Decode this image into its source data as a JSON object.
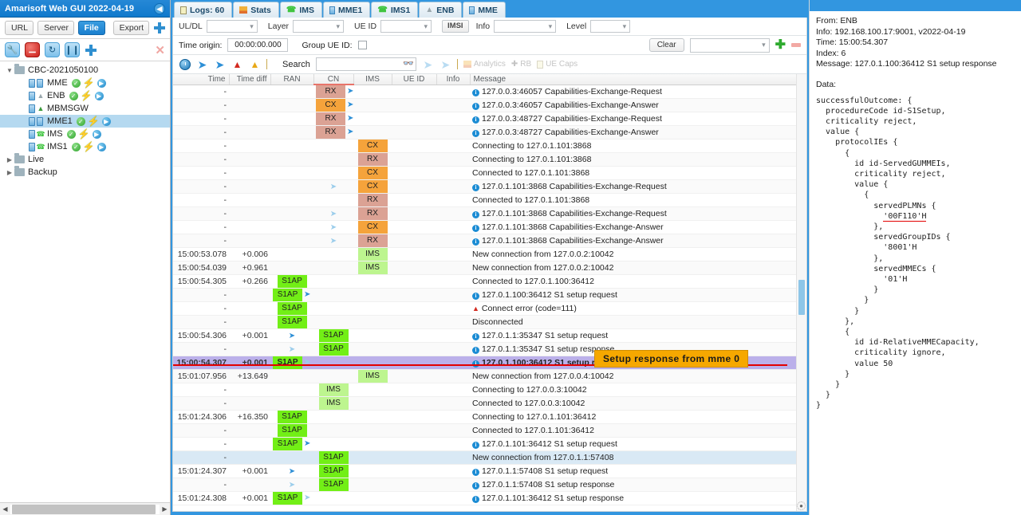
{
  "window": {
    "title": "Amarisoft Web GUI 2022-04-19",
    "collapse_icon": "chevron-left-icon"
  },
  "sidebar": {
    "source_buttons": [
      {
        "label": "URL",
        "active": false
      },
      {
        "label": "Server",
        "active": false
      },
      {
        "label": "File",
        "active": true
      }
    ],
    "export_label": "Export",
    "tool_icons": [
      "wrench-icon",
      "stop-icon",
      "refresh-icon",
      "pause-icon",
      "plus-icon",
      "close-icon"
    ],
    "tree": [
      {
        "label": "CBC-2021050100",
        "type": "folder",
        "expanded": true,
        "depth": 0,
        "selected": false,
        "status": []
      },
      {
        "label": "MME",
        "type": "server",
        "depth": 1,
        "selected": false,
        "status": [
          "check",
          "bolt",
          "play"
        ]
      },
      {
        "label": "ENB",
        "type": "enb",
        "depth": 1,
        "selected": false,
        "status": [
          "check",
          "bolt",
          "play"
        ]
      },
      {
        "label": "MBMSGW",
        "type": "gw",
        "depth": 1,
        "selected": false,
        "status": []
      },
      {
        "label": "MME1",
        "type": "server",
        "depth": 1,
        "selected": true,
        "status": [
          "check",
          "bolt",
          "play"
        ]
      },
      {
        "label": "IMS",
        "type": "phone",
        "depth": 1,
        "selected": false,
        "status": [
          "check",
          "bolt",
          "play"
        ]
      },
      {
        "label": "IMS1",
        "type": "phone",
        "depth": 1,
        "selected": false,
        "status": [
          "check",
          "bolt",
          "play"
        ]
      },
      {
        "label": "Live",
        "type": "folder",
        "expanded": false,
        "depth": 0,
        "selected": false,
        "status": []
      },
      {
        "label": "Backup",
        "type": "folder",
        "expanded": false,
        "depth": 0,
        "selected": false,
        "status": []
      }
    ]
  },
  "tabs": [
    {
      "label": "Logs: 60",
      "icon": "log-icon",
      "active": false
    },
    {
      "label": "Stats",
      "icon": "stats-icon",
      "active": false
    },
    {
      "label": "IMS",
      "icon": "phone-icon",
      "active": false
    },
    {
      "label": "MME1",
      "icon": "server-icon",
      "active": false
    },
    {
      "label": "IMS1",
      "icon": "phone-icon",
      "active": false
    },
    {
      "label": "ENB",
      "icon": "enb-icon",
      "active": false
    },
    {
      "label": "MME",
      "icon": "server-icon",
      "active": false
    }
  ],
  "filters": {
    "uldl_label": "UL/DL",
    "uldl_value": "",
    "layer_label": "Layer",
    "layer_value": "",
    "ueid_label": "UE ID",
    "ueid_value": "",
    "imsi_button": "IMSI",
    "info_label": "Info",
    "info_value": "",
    "level_label": "Level",
    "level_value": "",
    "time_origin_label": "Time origin:",
    "time_origin_value": "00:00:00.000",
    "group_ueid_label": "Group UE ID:",
    "group_ueid_checked": false,
    "clear_label": "Clear",
    "preset_value": "",
    "add_icon": "green-plus-icon",
    "remove_icon": "red-minus-icon"
  },
  "toolbar": {
    "clock_icon": "clock-icon",
    "prev_icon": "arrow-left-icon",
    "next_icon": "arrow-right-icon",
    "error_icon": "error-triangle-icon",
    "warn_icon": "warning-triangle-icon",
    "search_label": "Search",
    "search_value": "",
    "binoculars_icon": "binoculars-icon",
    "search_prev_icon": "arrow-left-icon",
    "search_next_icon": "arrow-right-icon",
    "analytics_label": "Analytics",
    "rb_label": "RB",
    "uecaps_label": "UE Caps"
  },
  "table": {
    "columns": [
      "Time",
      "Time diff",
      "RAN",
      "CN",
      "IMS",
      "UE ID",
      "Info",
      "Message"
    ],
    "rows": [
      {
        "time": "-",
        "diff": "",
        "ran": "",
        "cn": "RX",
        "cn_arrow": "right",
        "ims": "",
        "ueid": "",
        "info": "",
        "msg": "127.0.0.3:46057 Capabilities-Exchange-Request",
        "badge": "info"
      },
      {
        "time": "-",
        "diff": "",
        "ran": "",
        "cn": "CX",
        "cn_arrow": "right",
        "ims": "",
        "ueid": "",
        "info": "",
        "msg": "127.0.0.3:46057 Capabilities-Exchange-Answer",
        "badge": "info"
      },
      {
        "time": "-",
        "diff": "",
        "ran": "",
        "cn": "RX",
        "cn_arrow": "right",
        "ims": "",
        "ueid": "",
        "info": "",
        "msg": "127.0.0.3:48727 Capabilities-Exchange-Request",
        "badge": "info"
      },
      {
        "time": "-",
        "diff": "",
        "ran": "",
        "cn": "RX",
        "cn_arrow": "right",
        "ims": "",
        "ueid": "",
        "info": "",
        "msg": "127.0.0.3:48727 Capabilities-Exchange-Answer",
        "badge": "info"
      },
      {
        "time": "-",
        "diff": "",
        "ran": "",
        "cn": "",
        "cn_arrow": "",
        "ims": "CX",
        "ims_arrow": "",
        "ueid": "",
        "info": "",
        "msg": "Connecting to 127.0.1.101:3868",
        "badge": ""
      },
      {
        "time": "-",
        "diff": "",
        "ran": "",
        "cn": "",
        "cn_arrow": "",
        "ims": "RX",
        "ims_arrow": "",
        "ueid": "",
        "info": "",
        "msg": "Connecting to 127.0.1.101:3868",
        "badge": ""
      },
      {
        "time": "-",
        "diff": "",
        "ran": "",
        "cn": "",
        "cn_arrow": "",
        "ims": "CX",
        "ims_arrow": "",
        "ueid": "",
        "info": "",
        "msg": "Connected to 127.0.1.101:3868",
        "badge": ""
      },
      {
        "time": "-",
        "diff": "",
        "ran": "",
        "cn": "",
        "cn_arrow": "rightpale",
        "ims": "CX",
        "ims_arrow": "",
        "ueid": "",
        "info": "",
        "msg": "127.0.1.101:3868 Capabilities-Exchange-Request",
        "badge": "info"
      },
      {
        "time": "-",
        "diff": "",
        "ran": "",
        "cn": "",
        "cn_arrow": "",
        "ims": "RX",
        "ims_arrow": "",
        "ueid": "",
        "info": "",
        "msg": "Connected to 127.0.1.101:3868",
        "badge": ""
      },
      {
        "time": "-",
        "diff": "",
        "ran": "",
        "cn": "",
        "cn_arrow": "rightpale",
        "ims": "RX",
        "ims_arrow": "",
        "ueid": "",
        "info": "",
        "msg": "127.0.1.101:3868 Capabilities-Exchange-Request",
        "badge": "info"
      },
      {
        "time": "-",
        "diff": "",
        "ran": "",
        "cn": "",
        "cn_arrow": "rightpale",
        "ims": "CX",
        "ims_arrow": "",
        "ueid": "",
        "info": "",
        "msg": "127.0.1.101:3868 Capabilities-Exchange-Answer",
        "badge": "info"
      },
      {
        "time": "-",
        "diff": "",
        "ran": "",
        "cn": "",
        "cn_arrow": "rightpale",
        "ims": "RX",
        "ims_arrow": "",
        "ueid": "",
        "info": "",
        "msg": "127.0.1.101:3868 Capabilities-Exchange-Answer",
        "badge": "info"
      },
      {
        "time": "15:00:53.078",
        "diff": "+0.006",
        "ran": "",
        "cn": "",
        "cn_arrow": "",
        "ims": "IMS",
        "ims_arrow": "",
        "ueid": "",
        "info": "",
        "msg": "New connection from 127.0.0.2:10042",
        "badge": ""
      },
      {
        "time": "15:00:54.039",
        "diff": "+0.961",
        "ran": "",
        "cn": "",
        "cn_arrow": "",
        "ims": "IMS",
        "ims_arrow": "",
        "ueid": "",
        "info": "",
        "msg": "New connection from 127.0.0.2:10042",
        "badge": ""
      },
      {
        "time": "15:00:54.305",
        "diff": "+0.266",
        "ran": "S1AP",
        "ran_arrow": "",
        "cn": "",
        "ims": "",
        "ueid": "",
        "info": "",
        "msg": "Connected to 127.0.1.100:36412",
        "badge": ""
      },
      {
        "time": "-",
        "diff": "",
        "ran": "S1AP",
        "ran_arrow": "right",
        "cn": "",
        "ims": "",
        "ueid": "",
        "info": "",
        "msg": "127.0.1.100:36412 S1 setup request",
        "badge": "info"
      },
      {
        "time": "-",
        "diff": "",
        "ran": "S1AP",
        "ran_arrow": "",
        "cn": "",
        "ims": "",
        "ueid": "",
        "info": "",
        "msg": "Connect error (code=111)",
        "badge": "warn"
      },
      {
        "time": "-",
        "diff": "",
        "ran": "S1AP",
        "ran_arrow": "",
        "cn": "",
        "ims": "",
        "ueid": "",
        "info": "",
        "msg": "Disconnected",
        "badge": ""
      },
      {
        "time": "15:00:54.306",
        "diff": "+0.001",
        "ran": "",
        "ran_arrow": "right",
        "cn": "S1AP",
        "cn_arrow": "",
        "ims": "",
        "ueid": "",
        "info": "",
        "msg": "127.0.1.1:35347 S1 setup request",
        "badge": "info"
      },
      {
        "time": "-",
        "diff": "",
        "ran": "",
        "ran_arrow": "rightpale",
        "cn": "S1AP",
        "cn_arrow": "",
        "ims": "",
        "ueid": "",
        "info": "",
        "msg": "127.0.1.1:35347 S1 setup response",
        "badge": "info"
      },
      {
        "time": "15:00:54.307",
        "diff": "+0.001",
        "ran": "S1AP",
        "ran_arrow": "rightpale",
        "cn": "",
        "ims": "",
        "ueid": "",
        "info": "",
        "msg": "127.0.1.100:36412 S1 setup response",
        "badge": "info",
        "selected": true
      },
      {
        "time": "15:01:07.956",
        "diff": "+13.649",
        "ran": "",
        "cn": "",
        "ims": "IMS",
        "ims_arrow": "",
        "ueid": "",
        "info": "",
        "msg": "New connection from 127.0.0.4:10042",
        "badge": ""
      },
      {
        "time": "-",
        "diff": "",
        "ran": "",
        "cn": "IMS",
        "cn_arrow": "",
        "ims": "",
        "ueid": "",
        "info": "",
        "msg": "Connecting to 127.0.0.3:10042",
        "badge": ""
      },
      {
        "time": "-",
        "diff": "",
        "ran": "",
        "cn": "IMS",
        "cn_arrow": "",
        "ims": "",
        "ueid": "",
        "info": "",
        "msg": "Connected to 127.0.0.3:10042",
        "badge": ""
      },
      {
        "time": "15:01:24.306",
        "diff": "+16.350",
        "ran": "S1AP",
        "ran_arrow": "",
        "cn": "",
        "ims": "",
        "ueid": "",
        "info": "",
        "msg": "Connecting to 127.0.1.101:36412",
        "badge": ""
      },
      {
        "time": "-",
        "diff": "",
        "ran": "S1AP",
        "ran_arrow": "",
        "cn": "",
        "ims": "",
        "ueid": "",
        "info": "",
        "msg": "Connected to 127.0.1.101:36412",
        "badge": ""
      },
      {
        "time": "-",
        "diff": "",
        "ran": "S1AP",
        "ran_arrow": "right",
        "cn": "",
        "ims": "",
        "ueid": "",
        "info": "",
        "msg": "127.0.1.101:36412 S1 setup request",
        "badge": "info"
      },
      {
        "time": "-",
        "diff": "",
        "ran": "",
        "ran_arrow": "",
        "cn": "S1AP",
        "cn_arrow": "",
        "ims": "",
        "ueid": "",
        "info": "",
        "msg": "New connection from 127.0.1.1:57408",
        "badge": "",
        "highlight": true
      },
      {
        "time": "15:01:24.307",
        "diff": "+0.001",
        "ran": "",
        "ran_arrow": "right",
        "cn": "S1AP",
        "cn_arrow": "",
        "ims": "",
        "ueid": "",
        "info": "",
        "msg": "127.0.1.1:57408 S1 setup request",
        "badge": "info"
      },
      {
        "time": "-",
        "diff": "",
        "ran": "",
        "ran_arrow": "rightpale",
        "cn": "S1AP",
        "cn_arrow": "",
        "ims": "",
        "ueid": "",
        "info": "",
        "msg": "127.0.1.1:57408 S1 setup response",
        "badge": "info"
      },
      {
        "time": "15:01:24.308",
        "diff": "+0.001",
        "ran": "S1AP",
        "ran_arrow": "rightpale",
        "cn": "",
        "ims": "",
        "ueid": "",
        "info": "",
        "msg": "127.0.1.101:36412 S1 setup response",
        "badge": "info"
      }
    ]
  },
  "callout": {
    "text": "Setup response from mme 0",
    "background": "#f6a800"
  },
  "details": {
    "from": "From: ENB",
    "info": "Info: 192.168.100.17:9001, v2022-04-19",
    "time": "Time: 15:00:54.307",
    "index": "Index: 6",
    "message": "Message: 127.0.1.100:36412 S1 setup response",
    "data_label": "Data:",
    "asn_before": "successfulOutcome: {\n  procedureCode id-S1Setup,\n  criticality reject,\n  value {\n    protocolIEs {\n      {\n        id id-ServedGUMMEIs,\n        criticality reject,\n        value {\n          {\n            servedPLMNs {\n              ",
    "asn_highlight": "'00F110'H",
    "asn_after": "\n            },\n            servedGroupIDs {\n              '8001'H\n            },\n            servedMMECs {\n              '01'H\n            }\n          }\n        }\n      },\n      {\n        id id-RelativeMMECapacity,\n        criticality ignore,\n        value 50\n      }\n    }\n  }\n}"
  }
}
